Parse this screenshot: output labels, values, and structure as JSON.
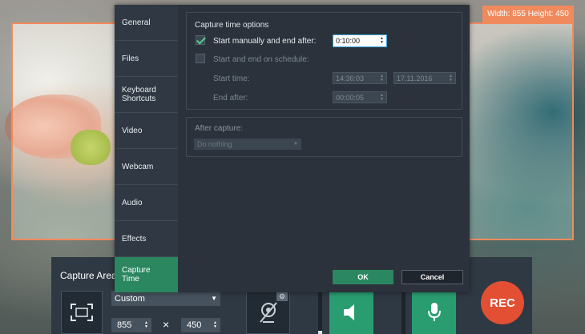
{
  "overlay": {
    "size_badge": "Width: 855 Height: 450",
    "frame_color": "#f08a5d"
  },
  "dialog": {
    "nav": [
      {
        "label": "General"
      },
      {
        "label": "Files"
      },
      {
        "label": "Keyboard Shortcuts"
      },
      {
        "label": "Video"
      },
      {
        "label": "Webcam"
      },
      {
        "label": "Audio"
      },
      {
        "label": "Effects"
      },
      {
        "label": "Capture Time",
        "active": true
      }
    ],
    "capture_time": {
      "group_title": "Capture time options",
      "manual_label": "Start manually and end after:",
      "manual_checked": true,
      "manual_value": "0:10:00",
      "schedule_label": "Start and end on schedule:",
      "schedule_checked": false,
      "start_time_label": "Start time:",
      "start_time_value": "14:36:03",
      "start_date_value": "17.11.2016",
      "end_after_label": "End after:",
      "end_after_value": "00:00:05"
    },
    "after_capture": {
      "group_title": "After capture:",
      "selected": "Do nothing"
    },
    "ok_label": "OK",
    "cancel_label": "Cancel"
  },
  "toolbar": {
    "title": "Capture Area",
    "preset": "Custom",
    "width": "855",
    "height": "450",
    "x_sign": "×",
    "rec_label": "REC",
    "system_audio_level": 0.08,
    "mic_level": 0.0
  },
  "colors": {
    "accent": "#2a8760",
    "rec": "#e24f33",
    "audio_button": "#2a9d70"
  }
}
